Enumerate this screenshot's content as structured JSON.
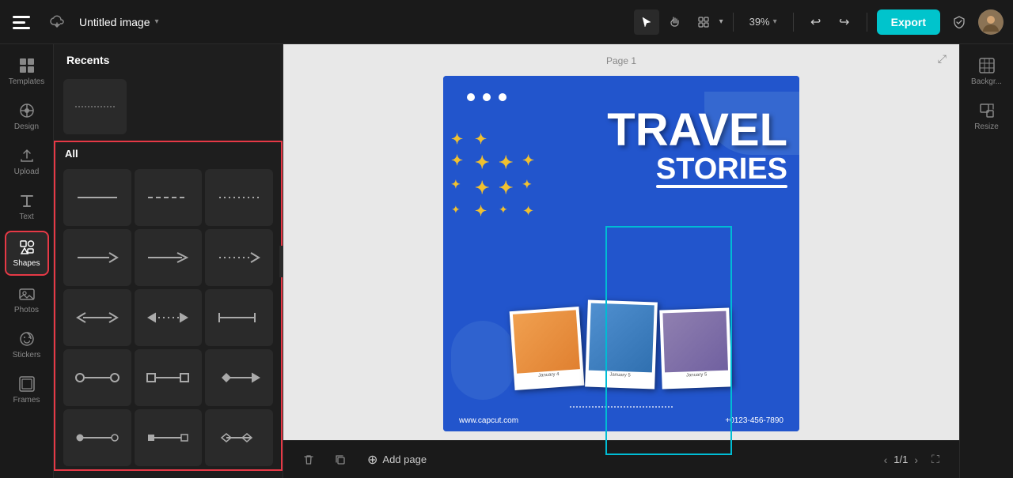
{
  "app": {
    "logo_text": "✂",
    "title": "Untitled image",
    "title_chevron": "▾"
  },
  "topbar": {
    "save_icon": "☁",
    "cursor_tool_label": "cursor",
    "hand_tool_label": "hand",
    "view_tool_label": "view",
    "zoom_value": "39%",
    "zoom_chevron": "▾",
    "undo_label": "↩",
    "redo_label": "↪",
    "export_label": "Export",
    "shield_label": "🛡",
    "avatar_label": "U"
  },
  "sidebar": {
    "items": [
      {
        "id": "templates",
        "label": "Templates",
        "icon": "templates"
      },
      {
        "id": "design",
        "label": "Design",
        "icon": "design"
      },
      {
        "id": "upload",
        "label": "Upload",
        "icon": "upload"
      },
      {
        "id": "text",
        "label": "Text",
        "icon": "text"
      },
      {
        "id": "shapes",
        "label": "Shapes",
        "icon": "shapes"
      },
      {
        "id": "photos",
        "label": "Photos",
        "icon": "photos"
      },
      {
        "id": "stickers",
        "label": "Stickers",
        "icon": "stickers"
      },
      {
        "id": "frames",
        "label": "Frames",
        "icon": "frames"
      }
    ]
  },
  "shapes_panel": {
    "header": "Recents",
    "all_label": "All",
    "rows": [
      {
        "cells": [
          {
            "type": "line",
            "label": "solid line"
          },
          {
            "type": "dashed-line",
            "label": "dashed line"
          },
          {
            "type": "dotted-line",
            "label": "dotted line"
          }
        ]
      },
      {
        "cells": [
          {
            "type": "arrow-right",
            "label": "solid arrow right"
          },
          {
            "type": "arrow-right-open",
            "label": "open arrow right"
          },
          {
            "type": "dotted-arrow-right",
            "label": "dotted arrow right"
          }
        ]
      },
      {
        "cells": [
          {
            "type": "double-arrow",
            "label": "double arrow"
          },
          {
            "type": "dotted-double-arrow",
            "label": "dotted double arrow"
          },
          {
            "type": "extend-arrow",
            "label": "extend arrow"
          }
        ]
      },
      {
        "cells": [
          {
            "type": "circle-line",
            "label": "circle end line"
          },
          {
            "type": "rect-line",
            "label": "rect end line"
          },
          {
            "type": "diamond-arrow",
            "label": "diamond arrow"
          }
        ]
      },
      {
        "cells": [
          {
            "type": "circle-line-small",
            "label": "small circle line"
          },
          {
            "type": "rect-line-small",
            "label": "small rect line"
          },
          {
            "type": "diamond-small",
            "label": "small diamond"
          }
        ]
      }
    ]
  },
  "canvas": {
    "page_label": "Page 1",
    "design": {
      "dots": [
        "•",
        "•",
        "•"
      ],
      "title_line1": "TRAVEL",
      "title_line2": "STORIES",
      "website": "www.capcut.com",
      "phone": "+0123-456-7890",
      "photo_dates": [
        "January 4",
        "January 5",
        "January 5"
      ]
    }
  },
  "right_panel": {
    "items": [
      {
        "id": "background",
        "label": "Backgr..."
      },
      {
        "id": "resize",
        "label": "Resize"
      }
    ]
  },
  "bottom": {
    "add_page_label": "Add page",
    "page_current": "1/1",
    "trash_icon": "🗑",
    "copy_icon": "⧉"
  }
}
